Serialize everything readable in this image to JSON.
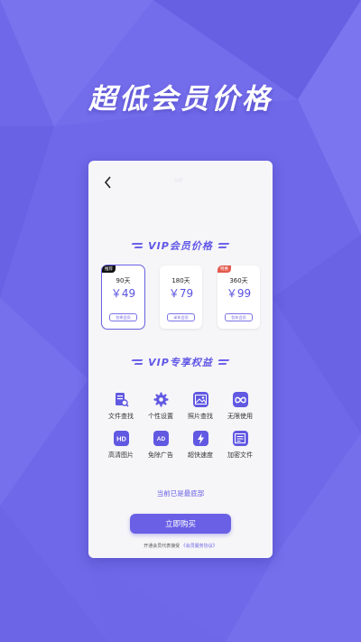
{
  "banner": {
    "title": "超低会员价格"
  },
  "nav": {
    "title": "VIP"
  },
  "sections": {
    "price_title": "VIP会员价格",
    "benefits_title": "VIP专享权益"
  },
  "plans": [
    {
      "tag": "推荐",
      "days": "90天",
      "price": "￥49",
      "note": "包季会员",
      "selected": true
    },
    {
      "tag": "",
      "days": "180天",
      "price": "￥79",
      "note": "半年会员",
      "selected": false
    },
    {
      "tag": "特惠",
      "days": "360天",
      "price": "￥99",
      "note": "包年会员",
      "selected": false
    }
  ],
  "benefits": [
    {
      "label": "文件查找",
      "icon": "file-search-icon"
    },
    {
      "label": "个性设置",
      "icon": "gear-icon"
    },
    {
      "label": "照片查找",
      "icon": "image-icon"
    },
    {
      "label": "无限使用",
      "icon": "infinity-icon"
    },
    {
      "label": "高清图片",
      "icon": "hd-icon"
    },
    {
      "label": "免除广告",
      "icon": "ad-icon"
    },
    {
      "label": "超快速度",
      "icon": "lightning-icon"
    },
    {
      "label": "加密文件",
      "icon": "encrypted-file-icon"
    }
  ],
  "footer": {
    "note": "当前已是最底部",
    "buy_label": "立即购买",
    "agree_prefix": "开通会员代表接受",
    "agree_link": "《会员服务协议》"
  },
  "colors": {
    "accent": "#6a60e6",
    "background": "#6f68e8",
    "badge_dark": "#111111",
    "badge_red": "#e35a4e"
  }
}
